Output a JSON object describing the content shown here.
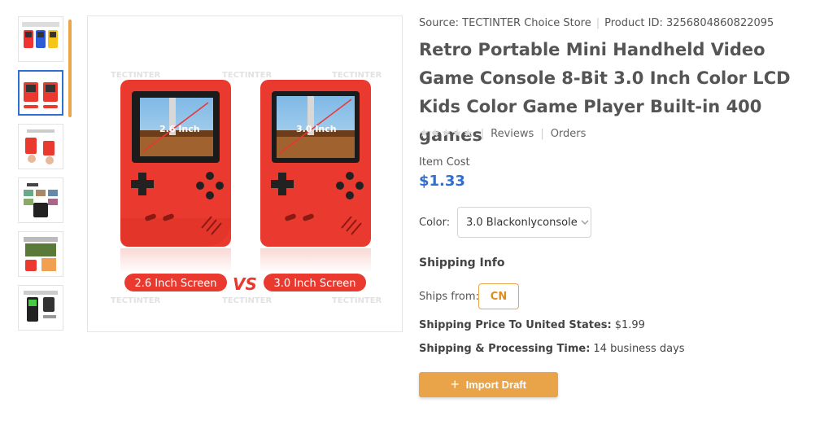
{
  "gallery": {
    "watermark": "TECTINTER",
    "left_label": "2.6 Inch Screen",
    "right_label": "3.0 Inch Screen",
    "vs": "VS",
    "left_screen": "2.6 Inch",
    "right_screen": "3.0 Inch",
    "thumb_count": 6
  },
  "product": {
    "source_label": "Source: TECTINTER Choice Store",
    "product_id_label": "Product ID: 3256804860822095",
    "title": "Retro Portable Mini Handheld Video Game Console 8-Bit 3.0 Inch Color LCD Kids Color Game Player Built-in 400 games",
    "stars": "★★★★★",
    "reviews": "Reviews",
    "orders": "Orders",
    "item_cost_label": "Item Cost",
    "item_cost": "$1.33",
    "color_label": "Color:",
    "color_value": "3.0 Blackonlyconsole"
  },
  "shipping": {
    "heading": "Shipping Info",
    "ships_from_label": "Ships from:",
    "ships_from": "CN",
    "price_label": "Shipping Price To United States:",
    "price": "$1.99",
    "time_label": "Shipping & Processing Time:",
    "time": "14 business days"
  },
  "actions": {
    "import_label": "Import Draft"
  },
  "colors": {
    "accent": "#e9a44a",
    "price": "#2f6fd1",
    "console_red": "#ea3a2f"
  }
}
